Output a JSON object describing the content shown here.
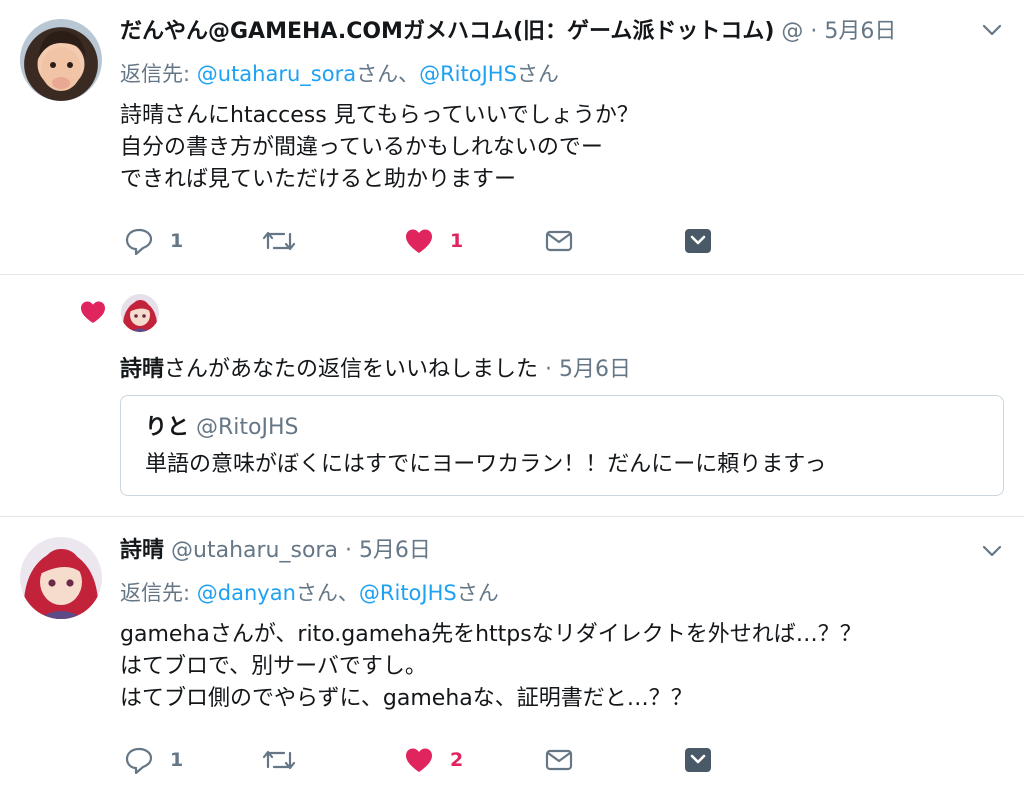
{
  "tweet1": {
    "author_name": "だんやん@GAMEHA.COMガメハコム(旧：ゲーム派ドットコム)",
    "author_handle": "@",
    "sep": "·",
    "date": "5月6日",
    "reply_prefix": "返信先:",
    "reply_user1": "@utaharu_sora",
    "reply_mid": "さん、",
    "reply_user2": "@RitoJHS",
    "reply_suffix": "さん",
    "lines": [
      "詩晴さんにhtaccess 見てもらっていいでしょうか？",
      "自分の書き方が間違っているかもしれないのでー",
      "できれば見ていただけると助かりますー"
    ],
    "reply_count": "1",
    "like_count": "1"
  },
  "notification": {
    "liker": "詩晴",
    "text": "さんがあなたの返信をいいねしました",
    "sep": "·",
    "date": "5月6日",
    "quote_name": "りと",
    "quote_handle": "@RitoJHS",
    "quote_text": "単語の意味がぼくにはすでにヨーワカラン！！だんにーに頼りますっ"
  },
  "tweet2": {
    "author_name": "詩晴",
    "author_handle": "@utaharu_sora",
    "sep": "·",
    "date": "5月6日",
    "reply_prefix": "返信先:",
    "reply_user1": "@danyan",
    "reply_mid": "さん、",
    "reply_user2": "@RitoJHS",
    "reply_suffix": "さん",
    "lines": [
      "gamehaさんが、rito.gameha先をhttpsなリダイレクトを外せれば…？？",
      "はてブロで、別サーバですし。",
      "はてブロ側のでやらずに、gamehaな、証明書だと…？？"
    ],
    "reply_count": "1",
    "like_count": "2"
  },
  "colors": {
    "like_red": "#e0245e",
    "link_blue": "#1da1f2",
    "muted_gray": "#657786",
    "divider": "#e1e8ed"
  },
  "icons": [
    "reply-icon",
    "retweet-icon",
    "like-icon",
    "dm-icon",
    "bookmark-icon",
    "chevron-down-icon"
  ]
}
